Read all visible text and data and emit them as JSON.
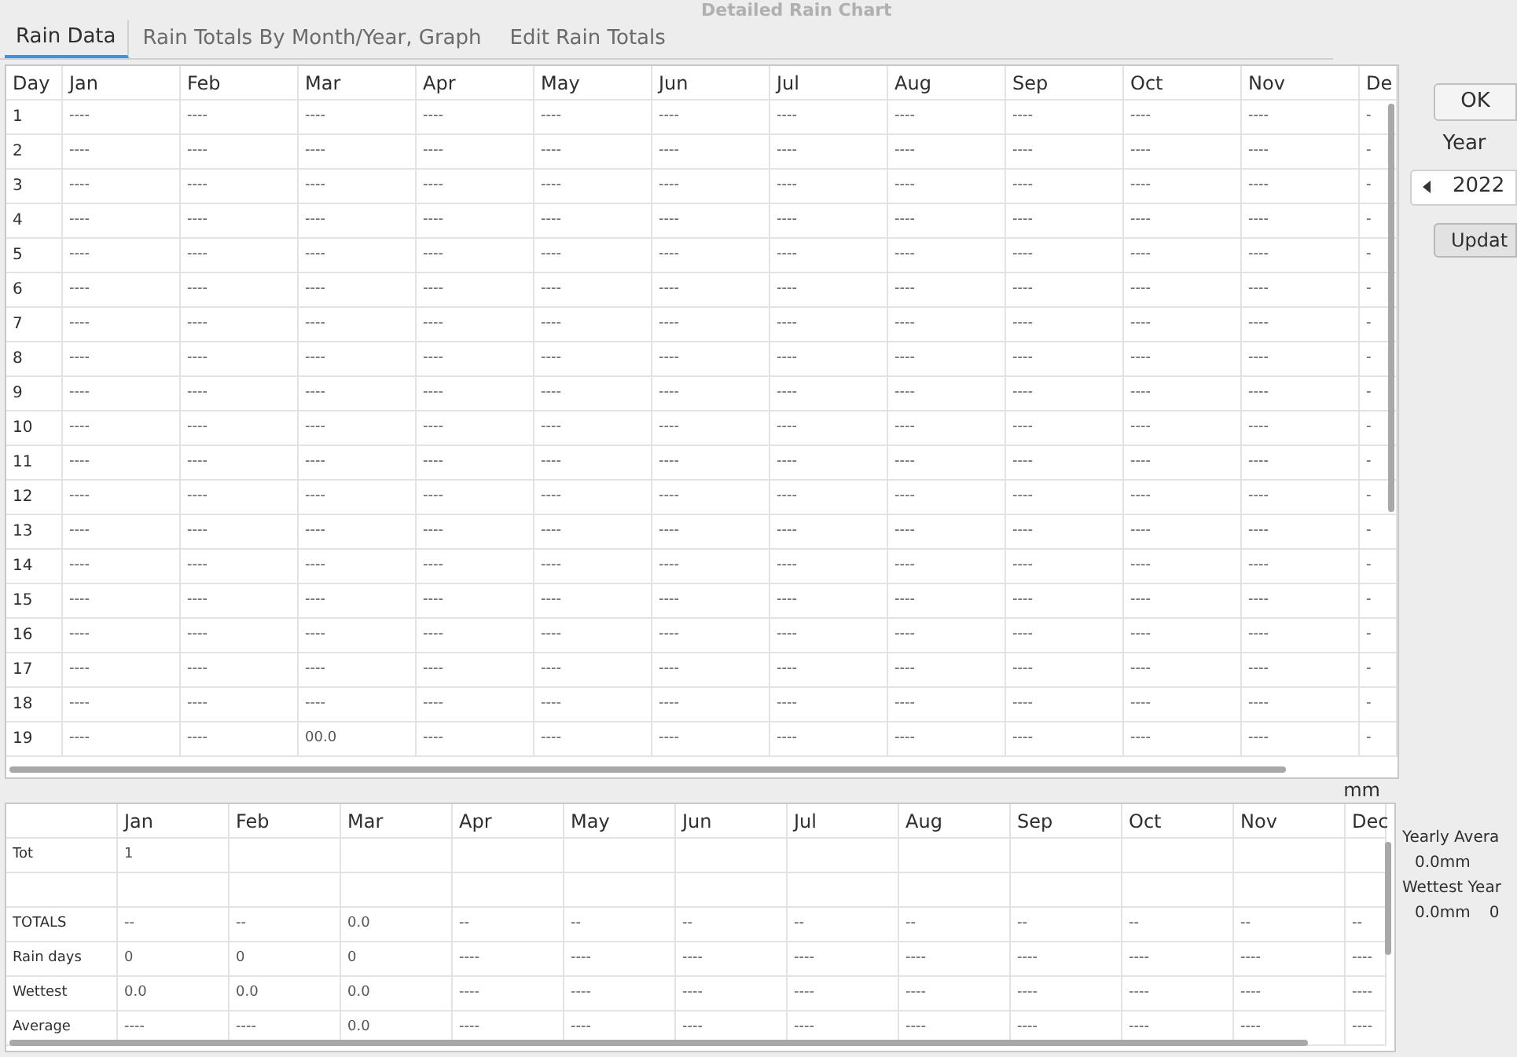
{
  "window": {
    "title": "Detailed Rain Chart"
  },
  "tabs": [
    {
      "label": "Rain Data",
      "selected": true
    },
    {
      "label": "Rain Totals By Month/Year, Graph",
      "selected": false
    },
    {
      "label": "Edit Rain Totals",
      "selected": false
    }
  ],
  "day_table": {
    "columns": [
      "Day",
      "Jan",
      "Feb",
      "Mar",
      "Apr",
      "May",
      "Jun",
      "Jul",
      "Aug",
      "Sep",
      "Oct",
      "Nov",
      "De"
    ],
    "rows": [
      [
        "1",
        "----",
        "----",
        "----",
        "----",
        "----",
        "----",
        "----",
        "----",
        "----",
        "----",
        "----",
        "-"
      ],
      [
        "2",
        "----",
        "----",
        "----",
        "----",
        "----",
        "----",
        "----",
        "----",
        "----",
        "----",
        "----",
        "-"
      ],
      [
        "3",
        "----",
        "----",
        "----",
        "----",
        "----",
        "----",
        "----",
        "----",
        "----",
        "----",
        "----",
        "-"
      ],
      [
        "4",
        "----",
        "----",
        "----",
        "----",
        "----",
        "----",
        "----",
        "----",
        "----",
        "----",
        "----",
        "-"
      ],
      [
        "5",
        "----",
        "----",
        "----",
        "----",
        "----",
        "----",
        "----",
        "----",
        "----",
        "----",
        "----",
        "-"
      ],
      [
        "6",
        "----",
        "----",
        "----",
        "----",
        "----",
        "----",
        "----",
        "----",
        "----",
        "----",
        "----",
        "-"
      ],
      [
        "7",
        "----",
        "----",
        "----",
        "----",
        "----",
        "----",
        "----",
        "----",
        "----",
        "----",
        "----",
        "-"
      ],
      [
        "8",
        "----",
        "----",
        "----",
        "----",
        "----",
        "----",
        "----",
        "----",
        "----",
        "----",
        "----",
        "-"
      ],
      [
        "9",
        "----",
        "----",
        "----",
        "----",
        "----",
        "----",
        "----",
        "----",
        "----",
        "----",
        "----",
        "-"
      ],
      [
        "10",
        "----",
        "----",
        "----",
        "----",
        "----",
        "----",
        "----",
        "----",
        "----",
        "----",
        "----",
        "-"
      ],
      [
        "11",
        "----",
        "----",
        "----",
        "----",
        "----",
        "----",
        "----",
        "----",
        "----",
        "----",
        "----",
        "-"
      ],
      [
        "12",
        "----",
        "----",
        "----",
        "----",
        "----",
        "----",
        "----",
        "----",
        "----",
        "----",
        "----",
        "-"
      ],
      [
        "13",
        "----",
        "----",
        "----",
        "----",
        "----",
        "----",
        "----",
        "----",
        "----",
        "----",
        "----",
        "-"
      ],
      [
        "14",
        "----",
        "----",
        "----",
        "----",
        "----",
        "----",
        "----",
        "----",
        "----",
        "----",
        "----",
        "-"
      ],
      [
        "15",
        "----",
        "----",
        "----",
        "----",
        "----",
        "----",
        "----",
        "----",
        "----",
        "----",
        "----",
        "-"
      ],
      [
        "16",
        "----",
        "----",
        "----",
        "----",
        "----",
        "----",
        "----",
        "----",
        "----",
        "----",
        "----",
        "-"
      ],
      [
        "17",
        "----",
        "----",
        "----",
        "----",
        "----",
        "----",
        "----",
        "----",
        "----",
        "----",
        "----",
        "-"
      ],
      [
        "18",
        "----",
        "----",
        "----",
        "----",
        "----",
        "----",
        "----",
        "----",
        "----",
        "----",
        "----",
        "-"
      ],
      [
        "19",
        "----",
        "----",
        "00.0",
        "----",
        "----",
        "----",
        "----",
        "----",
        "----",
        "----",
        "----",
        "-"
      ]
    ]
  },
  "unit_label": "mm",
  "totals_table": {
    "columns": [
      "Jan",
      "Feb",
      "Mar",
      "Apr",
      "May",
      "Jun",
      "Jul",
      "Aug",
      "Sep",
      "Oct",
      "Nov",
      "Dec"
    ],
    "rows": [
      {
        "label": "Tot",
        "cells": [
          "1",
          "",
          "",
          "",
          "",
          "",
          "",
          "",
          "",
          "",
          "",
          ""
        ]
      },
      {
        "label": "",
        "cells": [
          "",
          "",
          "",
          "",
          "",
          "",
          "",
          "",
          "",
          "",
          "",
          ""
        ]
      },
      {
        "label": "TOTALS",
        "cells": [
          "--",
          "--",
          "0.0",
          "--",
          "--",
          "--",
          "--",
          "--",
          "--",
          "--",
          "--",
          "--"
        ]
      },
      {
        "label": "Rain days",
        "cells": [
          "0",
          "0",
          "0",
          "----",
          "----",
          "----",
          "----",
          "----",
          "----",
          "----",
          "----",
          "----"
        ]
      },
      {
        "label": "Wettest",
        "cells": [
          "0.0",
          "0.0",
          "0.0",
          "----",
          "----",
          "----",
          "----",
          "----",
          "----",
          "----",
          "----",
          "----"
        ]
      },
      {
        "label": "Average",
        "cells": [
          "----",
          "----",
          "0.0",
          "----",
          "----",
          "----",
          "----",
          "----",
          "----",
          "----",
          "----",
          "----"
        ]
      }
    ]
  },
  "side_panel": {
    "ok_button": "OK",
    "year_label": "Year",
    "year_value": "2022",
    "update_button": "Updat",
    "yearly_average_label": "Yearly Avera",
    "yearly_average_value": "0.0mm",
    "wettest_year_label": "Wettest Year",
    "wettest_year_value": "0.0mm",
    "wettest_year_year": "0"
  }
}
